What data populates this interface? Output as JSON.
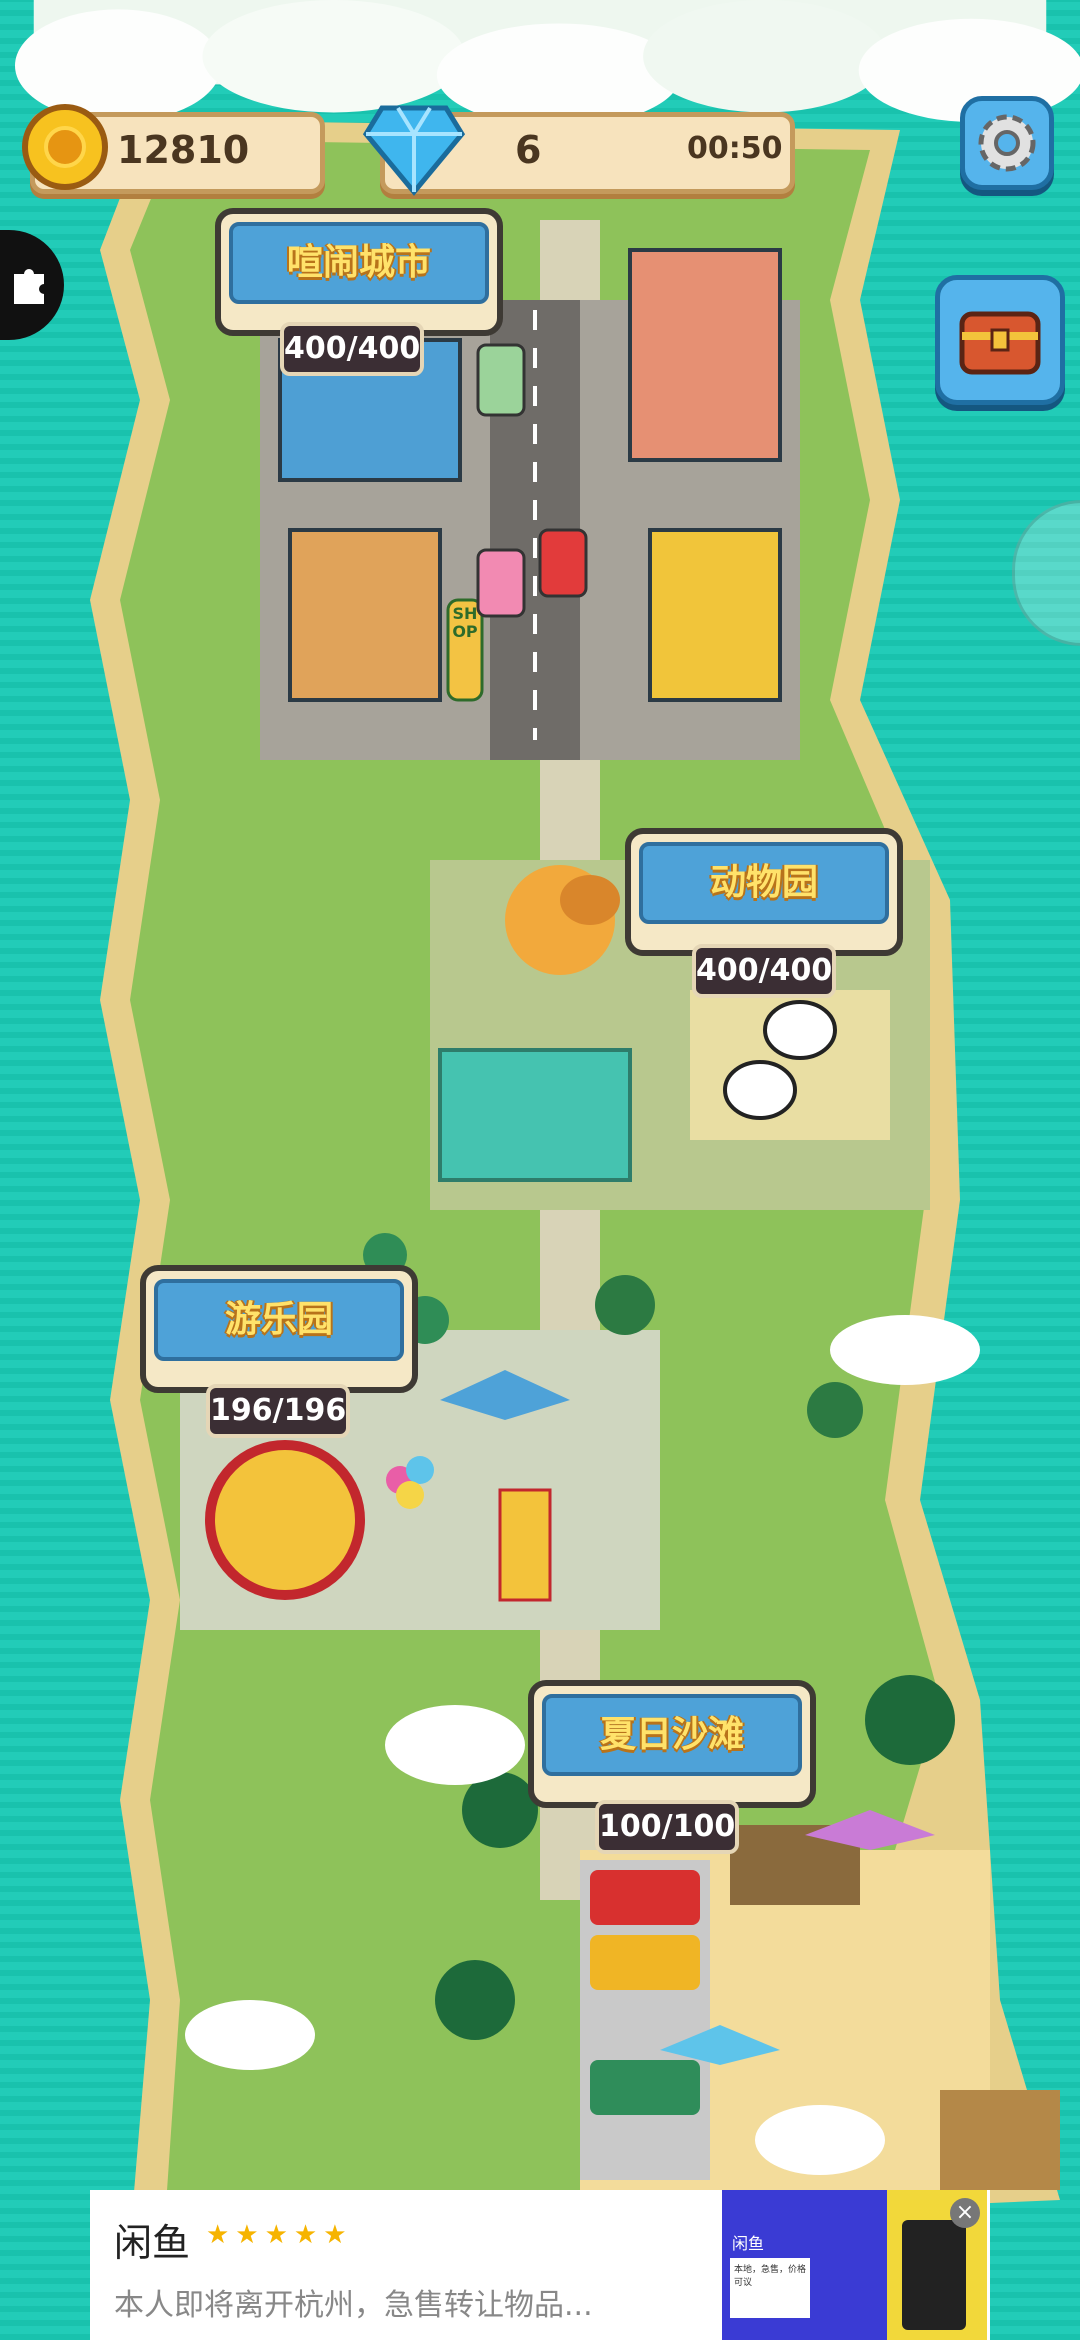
{
  "hud": {
    "coins": "12810",
    "gems": "6",
    "timer": "00:50"
  },
  "icons": {
    "coin": "coin-icon",
    "gem": "diamond-icon",
    "settings": "gear-icon",
    "chest": "treasure-chest-icon",
    "puzzle": "puzzle-icon"
  },
  "areas": [
    {
      "name": "喧闹城市",
      "progress": "400/400"
    },
    {
      "name": "动物园",
      "progress": "400/400"
    },
    {
      "name": "游乐园",
      "progress": "196/196"
    },
    {
      "name": "夏日沙滩",
      "progress": "100/100"
    }
  ],
  "map_labels": {
    "shop_sign": "SHOP"
  },
  "ad": {
    "app_name": "闲鱼",
    "rating_stars": "★★★★★",
    "text": "本人即将离开杭州，急售转让物品...",
    "thumb_title": "闲鱼",
    "thumb_text": "本地，急售，价格可议"
  },
  "colors": {
    "sea": "#1ec9b4",
    "land": "#8ec25a",
    "label_blue": "#4ea2d8",
    "label_text": "#ffe26a"
  }
}
